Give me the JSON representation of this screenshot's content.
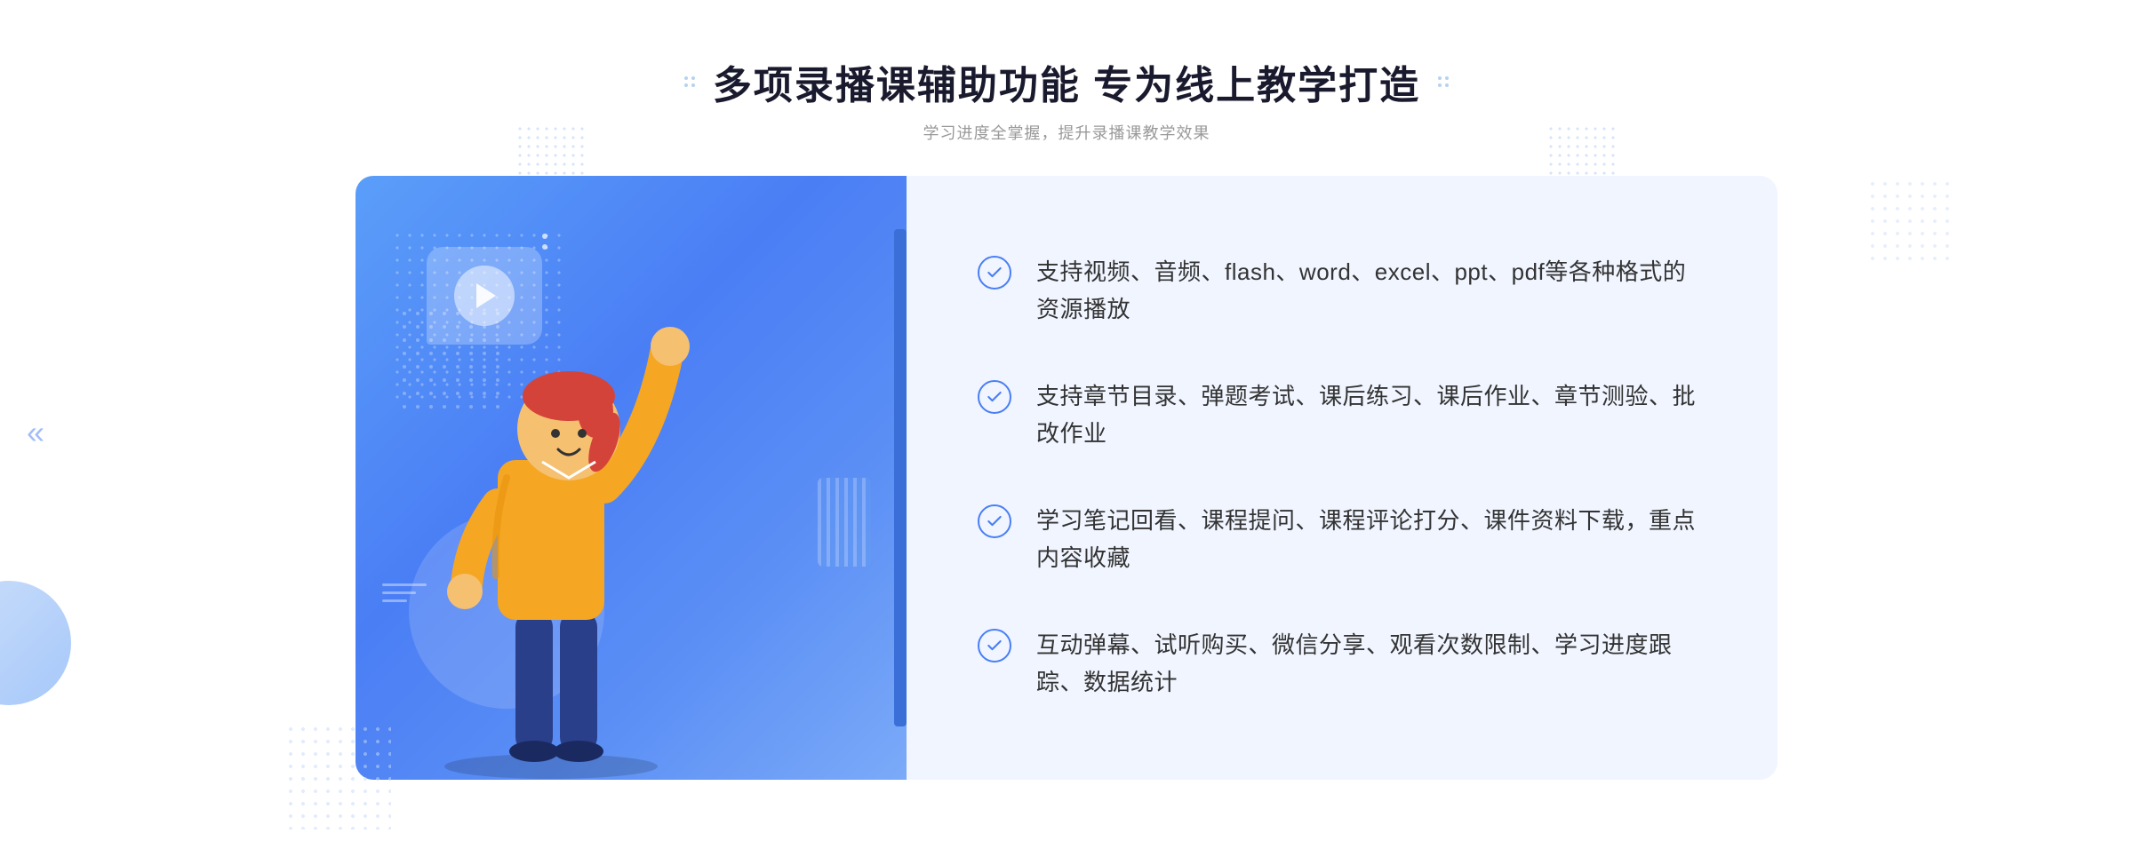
{
  "header": {
    "title": "多项录播课辅助功能 专为线上教学打造",
    "subtitle": "学习进度全掌握，提升录播课教学效果"
  },
  "features": [
    {
      "id": 1,
      "text": "支持视频、音频、flash、word、excel、ppt、pdf等各种格式的资源播放"
    },
    {
      "id": 2,
      "text": "支持章节目录、弹题考试、课后练习、课后作业、章节测验、批改作业"
    },
    {
      "id": 3,
      "text": "学习笔记回看、课程提问、课程评论打分、课件资料下载，重点内容收藏"
    },
    {
      "id": 4,
      "text": "互动弹幕、试听购买、微信分享、观看次数限制、学习进度跟踪、数据统计"
    }
  ],
  "colors": {
    "accent": "#4a7ef5",
    "title": "#1a1a2e",
    "subtitle": "#999999",
    "feature_text": "#333333",
    "bg_panel": "#f0f5ff",
    "illustration_gradient_start": "#5b9ef9",
    "illustration_gradient_end": "#7baaf8"
  }
}
